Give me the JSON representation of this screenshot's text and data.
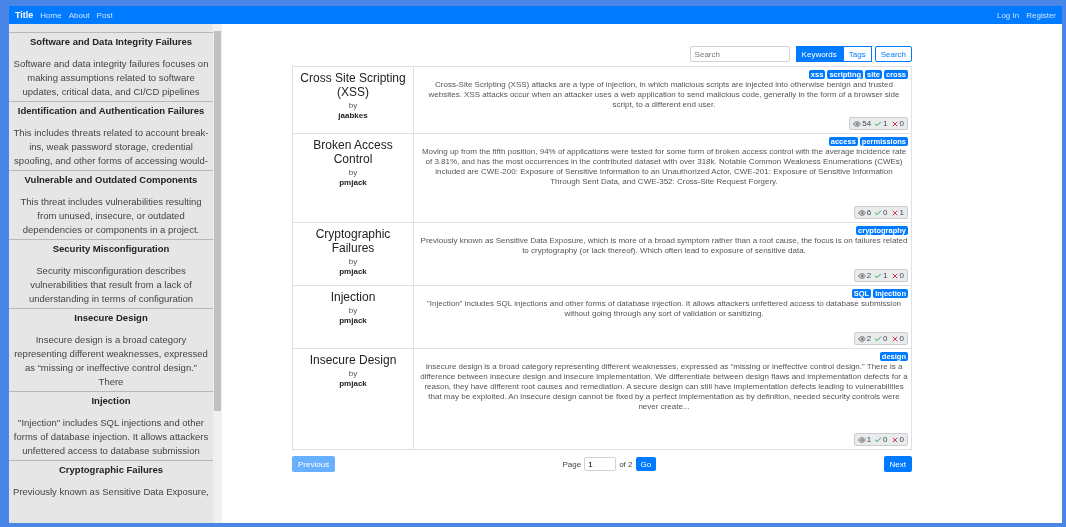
{
  "navbar": {
    "brand": "Title",
    "links": [
      "Home",
      "About",
      "Post"
    ],
    "right_links": [
      "Log In",
      "Register"
    ]
  },
  "sidebar": {
    "items": [
      {
        "title": "Software and Data Integrity Failures",
        "text": "Software and data integrity failures focuses on making assumptions related to software updates, critical data, and CI/CD pipelines"
      },
      {
        "title": "Identification and Authentication Failures",
        "text": "This includes threats related to account break-ins, weak password storage, credential spoofing, and other forms of accessing would-"
      },
      {
        "title": "Vulnerable and Outdated Components",
        "text": "This threat includes vulnerabilities resulting from unused, insecure, or outdated dependencies or components in a project."
      },
      {
        "title": "Security Misconfiguration",
        "text": "Security misconfiguration describes vulnerabilities that result from a lack of understanding in terms of configuration"
      },
      {
        "title": "Insecure Design",
        "text": "Insecure design is a broad category representing different weaknesses, expressed as “missing or ineffective control design.” There"
      },
      {
        "title": "Injection",
        "text": "\"Injection\" includes SQL injections and other forms of database injection. It allows attackers unfettered access to database submission"
      },
      {
        "title": "Cryptographic Failures",
        "text": "Previously known as Sensitive Data Exposure,"
      }
    ]
  },
  "search": {
    "placeholder": "Search",
    "modes": [
      {
        "label": "Keywords",
        "selected": true
      },
      {
        "label": "Tags",
        "selected": false
      }
    ],
    "button": "Search"
  },
  "posts": [
    {
      "title": "Cross Site Scripting (XSS)",
      "by": "by",
      "author": "jaabkes",
      "tags": [
        "xss",
        "scripting",
        "site",
        "cross"
      ],
      "text": "Cross-Site Scripting (XSS) attacks are a type of injection, in which malicious scripts are injected into otherwise benign and trusted websites. XSS attacks occur when an attacker uses a web application to send malicious code, generally in the form of a browser side script, to a different end user.",
      "views": "54",
      "up": "1",
      "down": "0"
    },
    {
      "title": "Broken Access Control",
      "by": "by",
      "author": "pmjack",
      "tags": [
        "access",
        "permissions"
      ],
      "text": "Moving up from the fifth position, 94% of applications were tested for some form of broken access control with the average incidence rate of 3.81%, and has the most occurrences in the contributed dataset with over 318k. Notable Common Weakness Enumerations (CWEs) included are CWE-200: Exposure of Sensitive Information to an Unauthorized Actor, CWE-201: Exposure of Sensitive Information Through Sent Data, and CWE-352: Cross-Site Request Forgery.",
      "views": "6",
      "up": "0",
      "down": "1"
    },
    {
      "title": "Cryptographic Failures",
      "by": "by",
      "author": "pmjack",
      "tags": [
        "cryptography"
      ],
      "text": "Previously known as Sensitive Data Exposure, which is more of a broad symptom rather than a root cause, the focus is on failures related to cryptography (or lack thereof). Which often lead to exposure of sensitive data.",
      "views": "2",
      "up": "1",
      "down": "0"
    },
    {
      "title": "Injection",
      "by": "by",
      "author": "pmjack",
      "tags": [
        "SQL",
        "Injection"
      ],
      "text": "\"Injection\" includes SQL injections and other forms of database injection. It allows attackers unfettered access to database submission without going through any sort of validation or sanitizing.",
      "views": "2",
      "up": "0",
      "down": "0"
    },
    {
      "title": "Insecure Design",
      "by": "by",
      "author": "pmjack",
      "tags": [
        "design"
      ],
      "text": "Insecure design is a broad category representing different weaknesses, expressed as “missing or ineffective control design.” There is a difference between insecure design and insecure implementation. We differentiate between design flaws and implementation defects for a reason, they have different root causes and remediation. A secure design can still have implementation defects leading to vulnerabilities that may be exploited. An insecure design cannot be fixed by a perfect implementation as by definition, needed security controls were never create...",
      "views": "1",
      "up": "0",
      "down": "0"
    }
  ],
  "pagination": {
    "previous": {
      "label": "Previous",
      "disabled": true
    },
    "page_label": "Page",
    "page": "1",
    "of": "of 2",
    "go": "Go",
    "next": {
      "label": "Next",
      "disabled": false
    }
  }
}
